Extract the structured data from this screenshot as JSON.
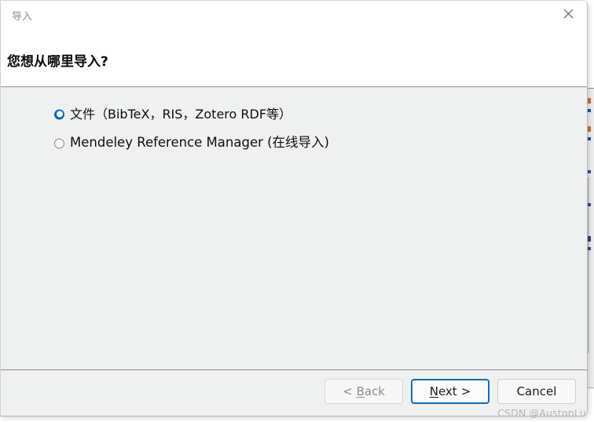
{
  "window": {
    "title": "导入",
    "close_icon": "close-icon"
  },
  "header": {
    "heading": "您想从哪里导入?"
  },
  "options": {
    "items": [
      {
        "label": "文件（BibTeX，RIS，Zotero RDF等）",
        "selected": true
      },
      {
        "label": "Mendeley Reference Manager (在线导入)",
        "selected": false
      }
    ]
  },
  "footer": {
    "buttons": {
      "back": {
        "prefix": "<",
        "accel": "B",
        "rest": "ack",
        "state": "disabled"
      },
      "next": {
        "accel": "N",
        "rest": "ext",
        "suffix": ">",
        "state": "default"
      },
      "cancel": {
        "label": "Cancel",
        "state": "normal"
      }
    }
  },
  "watermark": {
    "text": "CSDN @AustonLu"
  },
  "colors": {
    "accent": "#0067c0",
    "focus_border": "#0f6cbd",
    "title_text": "#8b8b8b",
    "body_bg": "#eff0f0"
  }
}
